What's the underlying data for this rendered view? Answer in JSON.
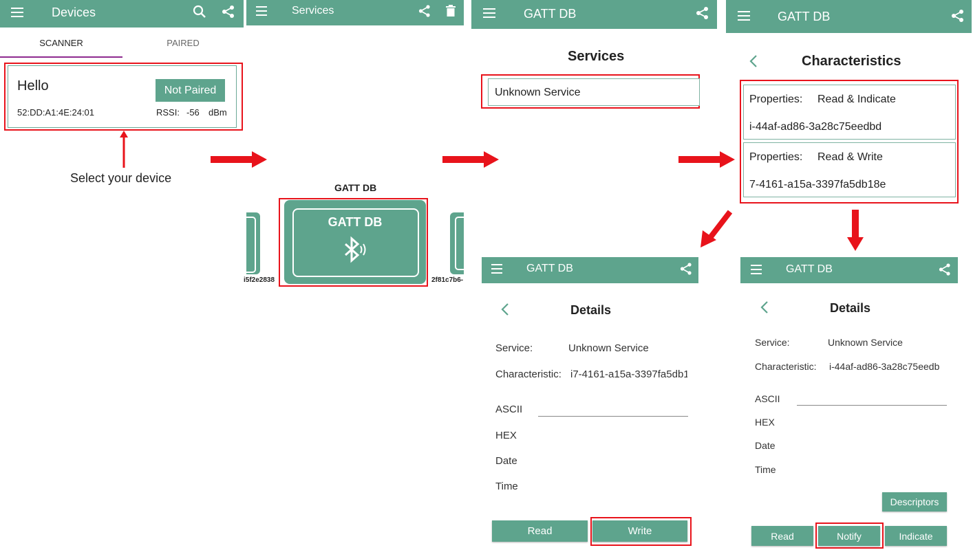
{
  "panel1": {
    "title": "Devices",
    "tabs": [
      "SCANNER",
      "PAIRED"
    ],
    "device": {
      "name": "Hello",
      "status": "Not Paired",
      "mac": "52:DD:A1:4E:24:01",
      "rssi_label": "RSSI:",
      "rssi_value": "-56",
      "rssi_unit": "dBm"
    },
    "hint": "Select your device"
  },
  "panel2": {
    "title": "Services",
    "card_label": "GATT DB",
    "card_title": "GATT DB",
    "left_card_id": "i5f2e2838",
    "right_card_id": "2f81c7b6-"
  },
  "panel3": {
    "title": "GATT DB",
    "heading": "Services",
    "service": "Unknown Service"
  },
  "panel4": {
    "title": "GATT DB",
    "heading": "Characteristics",
    "items": [
      {
        "prop_label": "Properties:",
        "prop_value": "Read & Indicate",
        "uuid": "i-44af-ad86-3a28c75eedbd"
      },
      {
        "prop_label": "Properties:",
        "prop_value": "Read & Write",
        "uuid": "7-4161-a15a-3397fa5db18e"
      }
    ]
  },
  "panel5": {
    "title": "GATT DB",
    "heading": "Details",
    "service_label": "Service:",
    "service_value": "Unknown Service",
    "char_label": "Characteristic:",
    "char_value": "i7-4161-a15a-3397fa5db1",
    "fields": [
      "ASCII",
      "HEX",
      "Date",
      "Time"
    ],
    "buttons": [
      "Read",
      "Write"
    ]
  },
  "panel6": {
    "title": "GATT DB",
    "heading": "Details",
    "service_label": "Service:",
    "service_value": "Unknown Service",
    "char_label": "Characteristic:",
    "char_value": "i-44af-ad86-3a28c75eedb",
    "fields": [
      "ASCII",
      "HEX",
      "Date",
      "Time"
    ],
    "descriptors": "Descriptors",
    "buttons": [
      "Read",
      "Notify",
      "Indicate"
    ]
  },
  "colors": {
    "primary": "#5ea48d",
    "accent_red": "#e8131b",
    "tab_indicator": "#8e2a8f"
  }
}
